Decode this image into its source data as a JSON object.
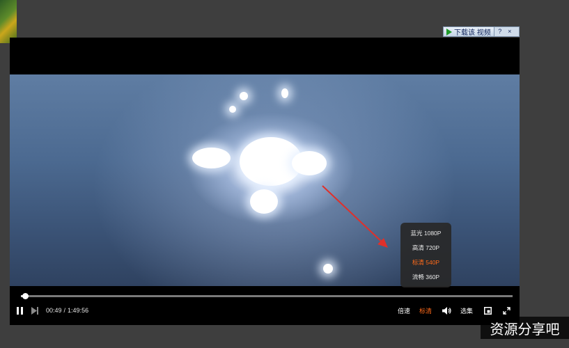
{
  "download_toolbar": {
    "download_label": "下载该 视频",
    "help_label": "?",
    "close_label": "×"
  },
  "player": {
    "progress_fraction": 0.0067,
    "time": {
      "current": "00:49",
      "separator": "/",
      "total": "1:49:56"
    },
    "controls": {
      "speed_label": "倍速",
      "quality_label": "标清",
      "episodes_label": "选集"
    },
    "quality_menu": {
      "options": [
        "蓝光 1080P",
        "高清 720P",
        "标清 540P",
        "流畅 360P"
      ],
      "selected": "标清 540P"
    }
  },
  "watermark": {
    "text": "资源分享吧"
  },
  "colors": {
    "accent": "#ff6a1a",
    "annotation_arrow": "#e0302a"
  },
  "icons": [
    "pause-icon",
    "next-icon",
    "volume-icon",
    "pip-icon",
    "fullscreen-icon",
    "play-triangle-icon"
  ]
}
